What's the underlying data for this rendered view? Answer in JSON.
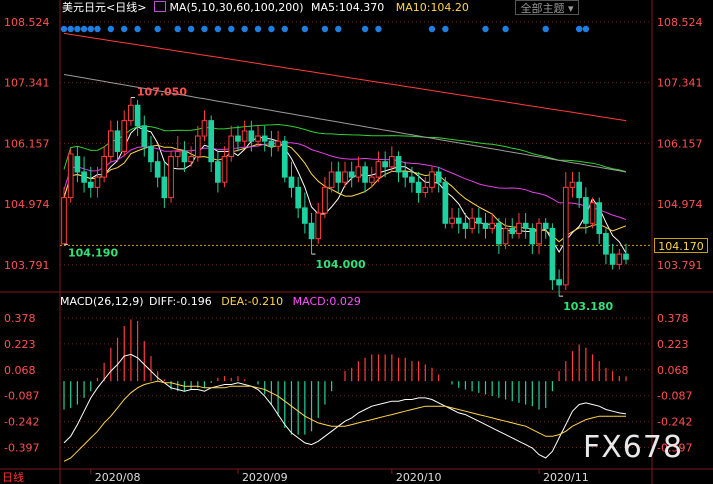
{
  "header": {
    "instrument": "美元日元",
    "period": "<日线>",
    "ma_label": "MA(5,10,30,60,100,200)",
    "ma5": "MA5:104.370",
    "ma10": "MA10:104.20",
    "theme_button": "全部主题"
  },
  "macd_header": {
    "label": "MACD(26,12,9)",
    "diff": "DIFF:-0.196",
    "dea": "DEA:-0.210",
    "macd": "MACD:0.029"
  },
  "current_price": "104.170",
  "period_tag": "日线",
  "watermark": "FX678",
  "colors": {
    "up": "#ff3b3b",
    "down": "#1fd1a0",
    "ma5": "#ffffff",
    "ma10": "#ffd54a",
    "ma30": "#e23fe6",
    "ma60": "#32d232",
    "ma100": "#9a9a9a",
    "ma200": "#ff3a3a",
    "grid": "#7a1a1a"
  },
  "chart_data": [
    {
      "type": "candlestick",
      "ylim": [
        103.3,
        108.6
      ],
      "y_ticks": [
        "108.524",
        "107.341",
        "106.157",
        "104.974",
        "103.791"
      ],
      "x_ticks": [
        "2020/08",
        "2020/09",
        "2020/10",
        "2020/11"
      ],
      "annotations": [
        "107.050",
        "104.190",
        "104.000",
        "103.180"
      ],
      "candles": [
        [
          104.2,
          105.1,
          105.3,
          104.19
        ],
        [
          105.1,
          105.95,
          106.05,
          105.0
        ],
        [
          105.9,
          105.6,
          106.1,
          105.4
        ],
        [
          105.6,
          105.4,
          105.9,
          105.2
        ],
        [
          105.4,
          105.3,
          105.7,
          105.1
        ],
        [
          105.3,
          105.5,
          105.7,
          105.1
        ],
        [
          105.5,
          105.9,
          106.1,
          105.4
        ],
        [
          105.9,
          106.4,
          106.6,
          105.8
        ],
        [
          106.4,
          106.0,
          106.6,
          105.8
        ],
        [
          106.0,
          106.6,
          106.8,
          105.9
        ],
        [
          106.6,
          106.9,
          107.05,
          106.5
        ],
        [
          106.9,
          106.5,
          107.0,
          106.3
        ],
        [
          106.5,
          106.1,
          106.7,
          105.9
        ],
        [
          106.1,
          105.8,
          106.3,
          105.6
        ],
        [
          105.8,
          105.5,
          106.0,
          105.3
        ],
        [
          105.5,
          105.1,
          105.8,
          104.9
        ],
        [
          105.1,
          105.9,
          106.0,
          105.0
        ],
        [
          105.9,
          106.0,
          106.3,
          105.7
        ],
        [
          106.0,
          105.8,
          106.2,
          105.6
        ],
        [
          105.8,
          105.9,
          106.1,
          105.7
        ],
        [
          105.9,
          106.3,
          106.5,
          105.8
        ],
        [
          106.3,
          106.6,
          106.8,
          106.2
        ],
        [
          106.6,
          105.8,
          106.7,
          105.6
        ],
        [
          105.8,
          105.4,
          106.0,
          105.2
        ],
        [
          105.4,
          105.9,
          106.1,
          105.3
        ],
        [
          105.9,
          106.3,
          106.5,
          105.8
        ],
        [
          106.3,
          106.2,
          106.5,
          106.0
        ],
        [
          106.2,
          106.4,
          106.6,
          106.1
        ],
        [
          106.4,
          106.2,
          106.6,
          106.0
        ],
        [
          106.2,
          106.3,
          106.5,
          106.1
        ],
        [
          106.3,
          106.2,
          106.5,
          106.0
        ],
        [
          106.2,
          106.1,
          106.4,
          105.9
        ],
        [
          106.1,
          106.2,
          106.4,
          106.0
        ],
        [
          106.2,
          105.5,
          106.3,
          105.4
        ],
        [
          105.5,
          105.3,
          105.8,
          105.1
        ],
        [
          105.3,
          104.9,
          105.5,
          104.7
        ],
        [
          104.9,
          104.6,
          105.2,
          104.4
        ],
        [
          104.6,
          104.3,
          104.8,
          104.0
        ],
        [
          104.3,
          104.8,
          105.0,
          104.2
        ],
        [
          104.8,
          105.3,
          105.5,
          104.7
        ],
        [
          105.3,
          105.6,
          105.8,
          105.2
        ],
        [
          105.6,
          105.4,
          105.8,
          105.2
        ],
        [
          105.4,
          105.6,
          105.8,
          105.3
        ],
        [
          105.6,
          105.5,
          105.8,
          105.3
        ],
        [
          105.5,
          105.7,
          105.9,
          105.4
        ],
        [
          105.7,
          105.4,
          105.8,
          105.2
        ],
        [
          105.4,
          105.5,
          105.7,
          105.3
        ],
        [
          105.5,
          105.8,
          106.0,
          105.4
        ],
        [
          105.8,
          105.7,
          106.0,
          105.5
        ],
        [
          105.7,
          105.9,
          106.1,
          105.6
        ],
        [
          105.9,
          105.6,
          106.0,
          105.4
        ],
        [
          105.6,
          105.5,
          105.8,
          105.3
        ],
        [
          105.5,
          105.4,
          105.7,
          105.2
        ],
        [
          105.4,
          105.2,
          105.6,
          105.0
        ],
        [
          105.2,
          105.3,
          105.5,
          105.1
        ],
        [
          105.3,
          105.6,
          105.7,
          105.2
        ],
        [
          105.6,
          105.4,
          105.7,
          105.2
        ],
        [
          105.4,
          104.6,
          105.5,
          104.5
        ],
        [
          104.6,
          104.7,
          104.9,
          104.5
        ],
        [
          104.7,
          104.6,
          104.9,
          104.4
        ],
        [
          104.6,
          104.5,
          104.8,
          104.3
        ],
        [
          104.5,
          104.7,
          104.9,
          104.4
        ],
        [
          104.7,
          104.6,
          104.9,
          104.4
        ],
        [
          104.6,
          104.5,
          104.8,
          104.3
        ],
        [
          104.5,
          104.6,
          104.8,
          104.4
        ],
        [
          104.6,
          104.2,
          104.7,
          104.0
        ],
        [
          104.2,
          104.5,
          104.7,
          104.1
        ],
        [
          104.5,
          104.4,
          104.7,
          104.3
        ],
        [
          104.4,
          104.6,
          104.8,
          104.3
        ],
        [
          104.6,
          104.5,
          104.8,
          104.3
        ],
        [
          104.5,
          104.2,
          104.6,
          104.0
        ],
        [
          104.2,
          104.6,
          104.7,
          104.0
        ],
        [
          104.6,
          104.5,
          104.7,
          104.3
        ],
        [
          104.5,
          103.5,
          104.6,
          103.3
        ],
        [
          103.5,
          103.4,
          103.7,
          103.18
        ],
        [
          103.4,
          105.3,
          105.6,
          103.3
        ],
        [
          105.3,
          105.4,
          105.6,
          105.1
        ],
        [
          105.4,
          105.1,
          105.6,
          104.9
        ],
        [
          105.1,
          104.6,
          105.3,
          104.4
        ],
        [
          104.6,
          105.0,
          105.1,
          104.5
        ],
        [
          105.0,
          104.4,
          105.1,
          104.2
        ],
        [
          104.4,
          104.0,
          104.5,
          103.8
        ],
        [
          104.0,
          103.8,
          104.2,
          103.7
        ],
        [
          103.8,
          104.0,
          104.1,
          103.7
        ],
        [
          104.0,
          103.9,
          104.2,
          103.8
        ]
      ]
    },
    {
      "type": "bar",
      "ylim": [
        -0.52,
        0.45
      ],
      "y_ticks": [
        "0.378",
        "0.223",
        "0.068",
        "-0.087",
        "-0.242",
        "-0.397"
      ],
      "series": [
        {
          "name": "DIFF",
          "values": [
            -0.37,
            -0.33,
            -0.26,
            -0.18,
            -0.1,
            -0.04,
            0.01,
            0.06,
            0.1,
            0.15,
            0.16,
            0.14,
            0.1,
            0.06,
            0.02,
            -0.01,
            -0.04,
            -0.05,
            -0.06,
            -0.05,
            -0.05,
            -0.06,
            -0.04,
            -0.03,
            -0.02,
            -0.02,
            -0.01,
            -0.02,
            -0.03,
            -0.05,
            -0.09,
            -0.14,
            -0.2,
            -0.26,
            -0.31,
            -0.34,
            -0.37,
            -0.38,
            -0.36,
            -0.33,
            -0.3,
            -0.27,
            -0.24,
            -0.22,
            -0.19,
            -0.17,
            -0.15,
            -0.14,
            -0.13,
            -0.12,
            -0.12,
            -0.11,
            -0.11,
            -0.1,
            -0.1,
            -0.11,
            -0.13,
            -0.15,
            -0.17,
            -0.19,
            -0.2,
            -0.22,
            -0.24,
            -0.26,
            -0.28,
            -0.3,
            -0.32,
            -0.34,
            -0.36,
            -0.38,
            -0.4,
            -0.44,
            -0.46,
            -0.42,
            -0.34,
            -0.26,
            -0.18,
            -0.14,
            -0.13,
            -0.14,
            -0.15,
            -0.17,
            -0.18,
            -0.19,
            -0.196
          ]
        },
        {
          "name": "DEA",
          "values": [
            -0.48,
            -0.46,
            -0.42,
            -0.38,
            -0.34,
            -0.3,
            -0.25,
            -0.21,
            -0.16,
            -0.11,
            -0.07,
            -0.04,
            -0.02,
            -0.01,
            0.0,
            -0.01,
            -0.01,
            -0.02,
            -0.03,
            -0.03,
            -0.03,
            -0.04,
            -0.04,
            -0.04,
            -0.04,
            -0.03,
            -0.03,
            -0.03,
            -0.03,
            -0.04,
            -0.05,
            -0.07,
            -0.09,
            -0.12,
            -0.15,
            -0.18,
            -0.21,
            -0.23,
            -0.25,
            -0.26,
            -0.27,
            -0.27,
            -0.27,
            -0.26,
            -0.25,
            -0.24,
            -0.23,
            -0.22,
            -0.21,
            -0.2,
            -0.19,
            -0.18,
            -0.17,
            -0.16,
            -0.15,
            -0.15,
            -0.15,
            -0.15,
            -0.16,
            -0.17,
            -0.18,
            -0.19,
            -0.2,
            -0.21,
            -0.22,
            -0.23,
            -0.24,
            -0.25,
            -0.26,
            -0.27,
            -0.29,
            -0.31,
            -0.33,
            -0.33,
            -0.32,
            -0.3,
            -0.27,
            -0.25,
            -0.23,
            -0.22,
            -0.21,
            -0.21,
            -0.21,
            -0.21,
            -0.21
          ]
        },
        {
          "name": "MACD",
          "values": [
            -0.17,
            -0.16,
            -0.14,
            -0.1,
            -0.06,
            0.02,
            0.11,
            0.2,
            0.26,
            0.33,
            0.37,
            0.36,
            0.24,
            0.15,
            0.06,
            0.01,
            -0.05,
            -0.06,
            -0.06,
            -0.05,
            -0.04,
            -0.04,
            -0.01,
            0.02,
            0.03,
            0.02,
            0.03,
            0.01,
            0.0,
            -0.02,
            -0.08,
            -0.14,
            -0.21,
            -0.28,
            -0.32,
            -0.32,
            -0.32,
            -0.3,
            -0.22,
            -0.14,
            -0.06,
            0.0,
            0.06,
            0.08,
            0.12,
            0.14,
            0.16,
            0.16,
            0.16,
            0.16,
            0.14,
            0.14,
            0.12,
            0.12,
            0.1,
            0.08,
            0.04,
            0.0,
            -0.02,
            -0.04,
            -0.05,
            -0.06,
            -0.07,
            -0.08,
            -0.09,
            -0.1,
            -0.11,
            -0.12,
            -0.13,
            -0.14,
            -0.15,
            -0.17,
            -0.16,
            -0.06,
            0.06,
            0.12,
            0.18,
            0.22,
            0.2,
            0.16,
            0.12,
            0.08,
            0.06,
            0.03,
            0.029
          ]
        }
      ]
    }
  ]
}
